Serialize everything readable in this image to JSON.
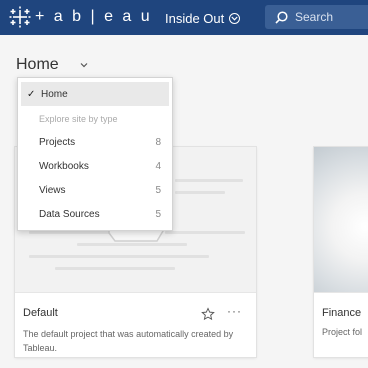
{
  "header": {
    "logo_text": "+ a b | e a u",
    "site_name": "Inside Out",
    "search_placeholder": "Search",
    "bg_color": "#1f457e"
  },
  "page": {
    "title": "Home"
  },
  "menu": {
    "selected": {
      "check": "✓",
      "label": "Home"
    },
    "section_label": "Explore site by type",
    "items": [
      {
        "label": "Projects",
        "count": "8"
      },
      {
        "label": "Workbooks",
        "count": "4"
      },
      {
        "label": "Views",
        "count": "5"
      },
      {
        "label": "Data Sources",
        "count": "5"
      }
    ]
  },
  "cards": {
    "default": {
      "title": "Default",
      "description": "The default project that was automatically created by Tableau.",
      "more": "···"
    },
    "finance": {
      "title": "Finance",
      "description": "Project fol"
    }
  }
}
